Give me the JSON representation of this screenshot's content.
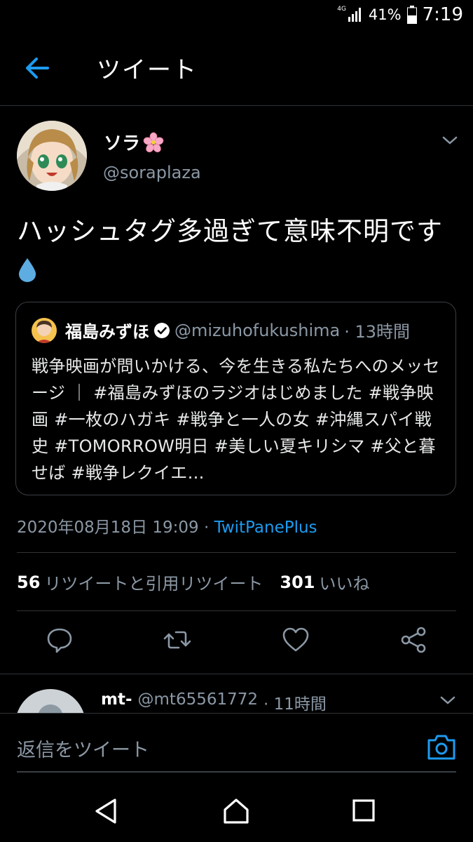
{
  "status_bar": {
    "network": "4G",
    "battery": "41%",
    "time": "7:19"
  },
  "header": {
    "title": "ツイート"
  },
  "tweet": {
    "author_name": "ソラ",
    "author_handle": "@soraplaza",
    "text": "ハッシュタグ多過ぎて意味不明です",
    "timestamp": "2020年08月18日 19:09 · ",
    "client": "TwitPanePlus"
  },
  "quote": {
    "name": "福島みずほ",
    "handle": "@mizuhofukushima",
    "time": "· 13時間",
    "text": "戦争映画が問いかける、今を生きる私たちへのメッセージ ｜ #福島みずほのラジオはじめました #戦争映画 #一枚のハガキ #戦争と一人の女 #沖縄スパイ戦史 #TOMORROW明日 #美しい夏キリシマ #父と暮せば #戦争レクイエ…"
  },
  "stats": {
    "retweets": "56",
    "retweets_label": "リツイートと引用リツイート",
    "likes": "301",
    "likes_label": "いいね"
  },
  "reply_preview": {
    "name": "mt-",
    "handle": "@mt65561772",
    "time": "· 11時間"
  },
  "composer": {
    "placeholder": "返信をツイート"
  },
  "colors": {
    "accent": "#1d9bf0",
    "muted": "#8b98a5",
    "background": "#000000",
    "divider": "#2f3336"
  }
}
